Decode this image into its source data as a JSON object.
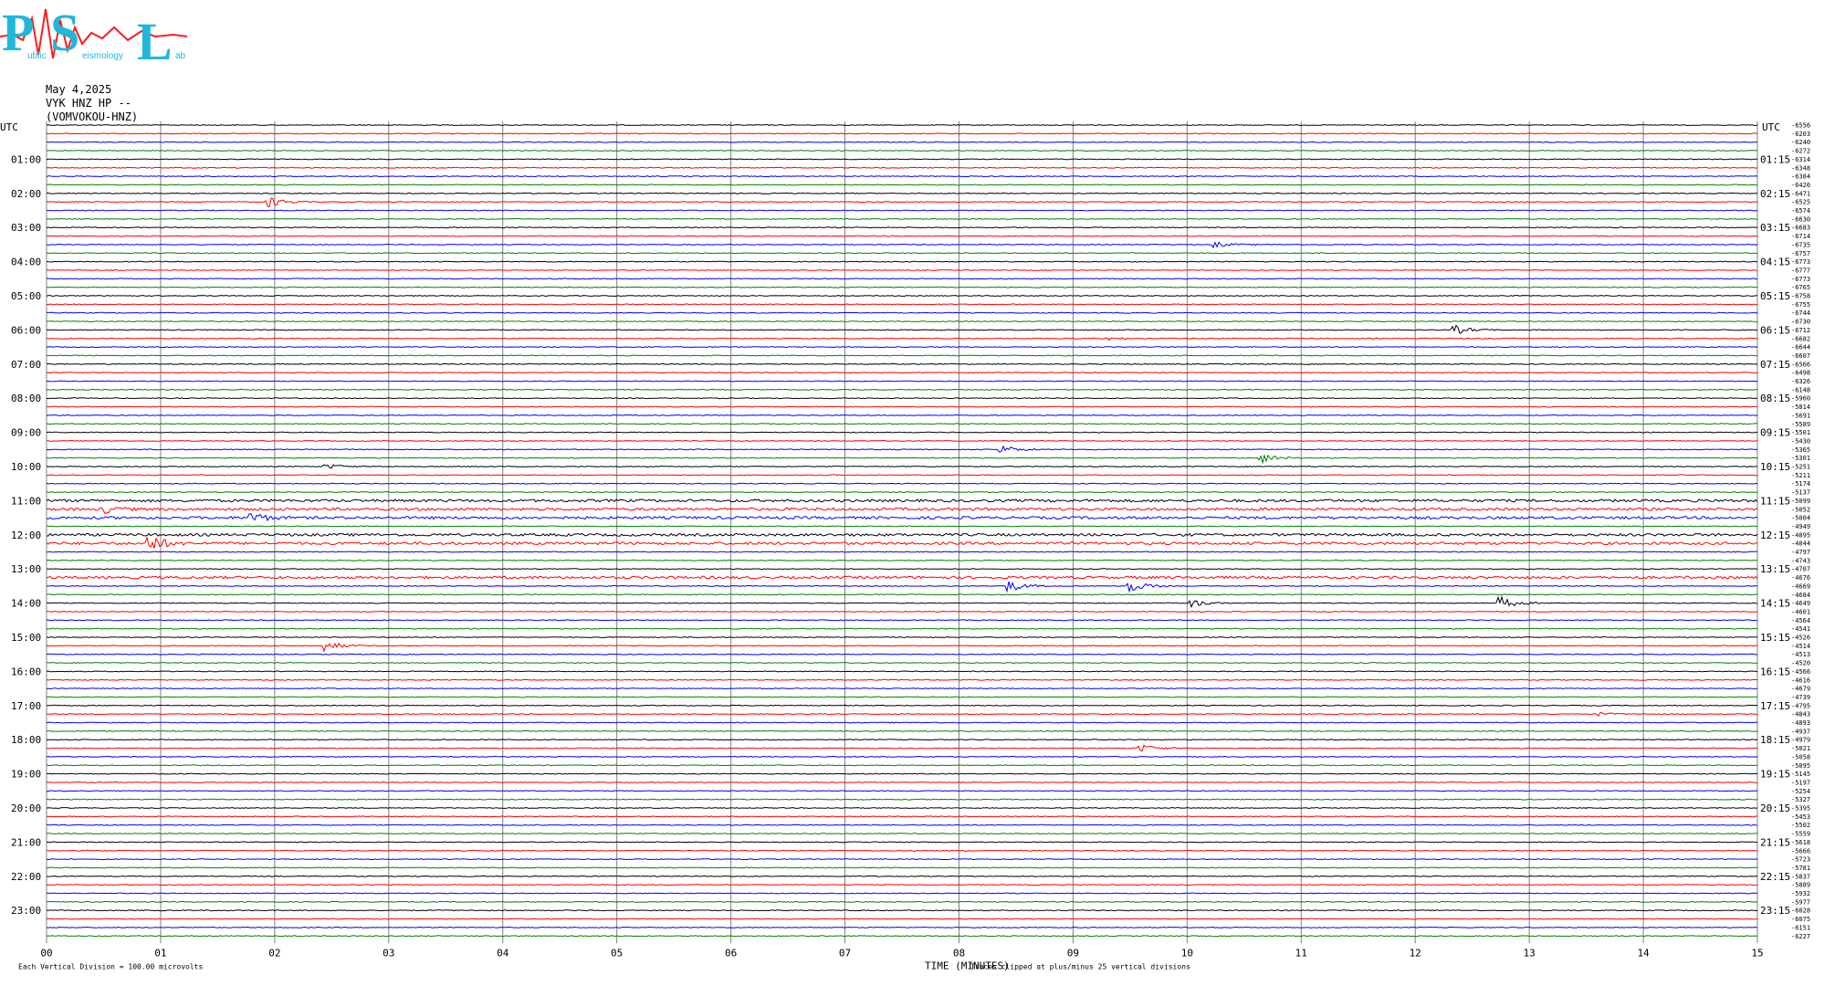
{
  "logo": {
    "letters": [
      "P",
      "S",
      "L"
    ],
    "small_words": [
      "ublic",
      "eismology",
      "ab"
    ],
    "colors": {
      "red": "#ff1a1a",
      "cyan": "#1fb8d8"
    }
  },
  "header": {
    "date": "May 4,2025",
    "station": "VYK HNZ HP --",
    "channel": "(VOMVOKOU-HNZ)"
  },
  "chart_data": {
    "type": "line",
    "subtype": "helicorder",
    "xlabel": "TIME (MINUTES)",
    "x_ticks": [
      "00",
      "01",
      "02",
      "03",
      "04",
      "05",
      "06",
      "07",
      "08",
      "09",
      "10",
      "11",
      "12",
      "13",
      "14",
      "15"
    ],
    "xlim": [
      0,
      15
    ],
    "left_axis_title": "UTC",
    "right_axis_title": "UTC",
    "left_hour_labels": [
      "01:00",
      "02:00",
      "03:00",
      "04:00",
      "05:00",
      "06:00",
      "07:00",
      "08:00",
      "09:00",
      "10:00",
      "11:00",
      "12:00",
      "13:00",
      "14:00",
      "15:00",
      "16:00",
      "17:00",
      "18:00",
      "19:00",
      "20:00",
      "21:00",
      "22:00",
      "23:00"
    ],
    "right_hour_labels": [
      "01:15",
      "02:15",
      "03:15",
      "04:15",
      "05:15",
      "06:15",
      "07:15",
      "08:15",
      "09:15",
      "10:15",
      "11:15",
      "12:15",
      "13:15",
      "14:15",
      "15:15",
      "16:15",
      "17:15",
      "18:15",
      "19:15",
      "20:15",
      "21:15",
      "22:15",
      "23:15"
    ],
    "traces_per_hour": 4,
    "trace_count": 96,
    "trace_color_cycle": [
      "#000000",
      "#ff0000",
      "#0000ff",
      "#008000"
    ],
    "right_offsets": [
      "-6556",
      "-6203",
      "-6240",
      "-6272",
      "-6314",
      "-6348",
      "-6384",
      "-6426",
      "-6471",
      "-6525",
      "-6574",
      "-6630",
      "-6683",
      "-6714",
      "-6735",
      "-6757",
      "-6773",
      "-6777",
      "-6773",
      "-6765",
      "-6758",
      "-6755",
      "-6744",
      "-6730",
      "-6712",
      "-6682",
      "-6644",
      "-6607",
      "-6566",
      "-6498",
      "-6326",
      "-6148",
      "-5960",
      "-5814",
      "-5691",
      "-5589",
      "-5501",
      "-5430",
      "-5365",
      "-5301",
      "-5251",
      "-5211",
      "-5174",
      "-5137",
      "-5099",
      "-5052",
      "-5004",
      "-4949",
      "-4895",
      "-4844",
      "-4797",
      "-4743",
      "-4707",
      "-4676",
      "-4669",
      "-4684",
      "-4649",
      "-4601",
      "-4564",
      "-4541",
      "-4526",
      "-4514",
      "-4513",
      "-4520",
      "-4566",
      "-4616",
      "-4679",
      "-4739",
      "-4795",
      "-4843",
      "-4893",
      "-4937",
      "-4979",
      "-5021",
      "-5058",
      "-5095",
      "-5145",
      "-5197",
      "-5254",
      "-5327",
      "-5395",
      "-5453",
      "-5502",
      "-5559",
      "-5618",
      "-5666",
      "-5723",
      "-5781",
      "-5837",
      "-5889",
      "-5932",
      "-5977",
      "-6028",
      "-6075",
      "-6151",
      "-6227"
    ],
    "events": [
      {
        "trace": 9,
        "minute": 1.95,
        "amplitude": 6
      },
      {
        "trace": 14,
        "minute": 10.25,
        "amplitude": 3
      },
      {
        "trace": 24,
        "minute": 12.35,
        "amplitude": 5
      },
      {
        "trace": 25,
        "minute": 9.3,
        "amplitude": 2
      },
      {
        "trace": 38,
        "minute": 8.35,
        "amplitude": 6
      },
      {
        "trace": 40,
        "minute": 2.45,
        "amplitude": 3
      },
      {
        "trace": 39,
        "minute": 10.65,
        "amplitude": 6
      },
      {
        "trace": 45,
        "minute": 0.5,
        "amplitude": 4
      },
      {
        "trace": 46,
        "minute": 1.8,
        "amplitude": 6
      },
      {
        "trace": 49,
        "minute": 0.9,
        "amplitude": 10
      },
      {
        "trace": 54,
        "minute": 8.45,
        "amplitude": 6
      },
      {
        "trace": 54,
        "minute": 9.5,
        "amplitude": 7
      },
      {
        "trace": 56,
        "minute": 10.05,
        "amplitude": 4
      },
      {
        "trace": 56,
        "minute": 12.75,
        "amplitude": 7
      },
      {
        "trace": 61,
        "minute": 2.45,
        "amplitude": 6
      },
      {
        "trace": 69,
        "minute": 13.6,
        "amplitude": 2
      },
      {
        "trace": 73,
        "minute": 9.6,
        "amplitude": 4
      }
    ],
    "noisy_traces": [
      44,
      45,
      46,
      48,
      49,
      53
    ],
    "footer_left": "Each Vertical Division =  100.00 microvolts",
    "footer_right": "Traces clipped at plus/minus 25 vertical divisions"
  }
}
